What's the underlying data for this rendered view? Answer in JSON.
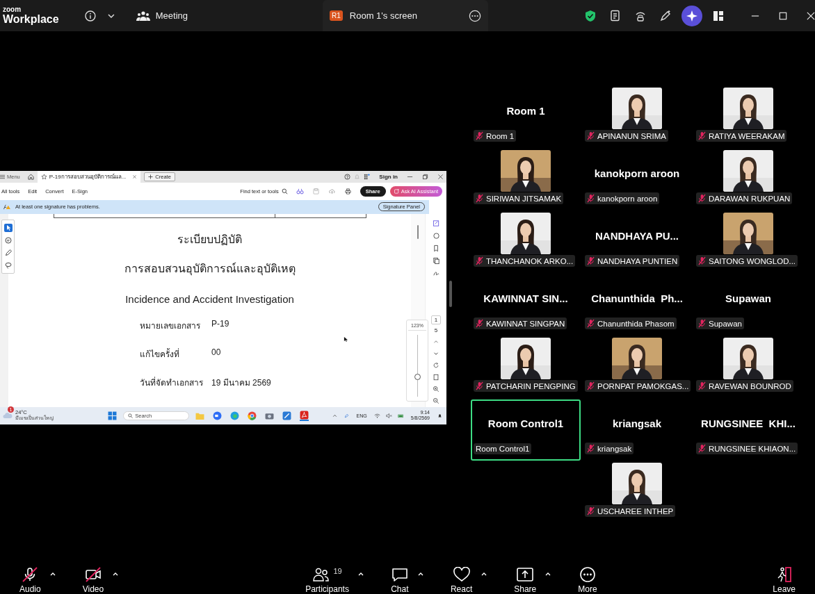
{
  "app": {
    "logo_small": "zoom",
    "logo_main": "Workplace"
  },
  "top_bar": {
    "meeting_label": "Meeting",
    "share_tab": {
      "badge": "R1",
      "title": "Room 1's screen"
    }
  },
  "shared_screen": {
    "acrobat": {
      "menu": "Menu",
      "tab_title": "P-19การสอบสวนอุบัติการณ์แล...",
      "create": "Create",
      "sign_in": "Sign in",
      "menus": [
        "All tools",
        "Edit",
        "Convert",
        "E-Sign"
      ],
      "find": "Find text or tools",
      "share": "Share",
      "ask_ai": "Ask AI Assistant",
      "banner": "At least one signature has problems.",
      "signature_panel": "Signature Panel"
    },
    "document": {
      "heading": "ระเบียบปฏิบัติ",
      "subheading": "การสอบสวนอุบัติการณ์และอุบัติเหตุ",
      "english_title": "Incidence and Accident Investigation",
      "fields": [
        {
          "label": "หมายเลขเอกสาร",
          "value": "P-19"
        },
        {
          "label": "แก้ไขครั้งที่",
          "value": "00"
        },
        {
          "label": "วันที่จัดทำเอกสาร",
          "value": "19 มีนาคม 2569"
        }
      ],
      "page_current": "1",
      "page_total": "5",
      "zoom": "123%"
    },
    "taskbar": {
      "weather_badge": "1",
      "temperature": "24°C",
      "weather": "มีเมฆเป็นส่วนใหญ่",
      "search": "Search",
      "language": "ENG",
      "time": "9:14",
      "date": "5/8/2569"
    }
  },
  "gallery": [
    {
      "kind": "name",
      "display": "Room 1",
      "label": "Room 1",
      "muted": true,
      "speaking": false
    },
    {
      "label": "APINANUN SRIMA",
      "muted": true,
      "speaking": false
    },
    {
      "label": "RATIYA WEERAKAM",
      "muted": true,
      "speaking": false
    },
    {
      "label": "SIRIWAN JITSAMAK",
      "muted": true,
      "speaking": false
    },
    {
      "kind": "name",
      "display": "kanokporn aroon",
      "label": "kanokporn aroon",
      "muted": true,
      "speaking": false
    },
    {
      "label": "DARAWAN RUKPUAN",
      "muted": true,
      "speaking": false
    },
    {
      "label": "THANCHANOK ARKO...",
      "muted": true,
      "speaking": false
    },
    {
      "kind": "name",
      "display": "NANDHAYA PU...",
      "label": "NANDHAYA PUNTIEN",
      "muted": true,
      "speaking": false
    },
    {
      "label": "SAITONG WONGLOD...",
      "muted": true,
      "speaking": false
    },
    {
      "kind": "name",
      "display": "KAWINNAT SIN...",
      "label": "KAWINNAT SINGPAN",
      "muted": true,
      "speaking": false
    },
    {
      "kind": "name",
      "display": "Chanunthida  Ph...",
      "label": "Chanunthida Phasom",
      "muted": true,
      "speaking": false
    },
    {
      "kind": "name",
      "display": "Supawan",
      "label": "Supawan",
      "muted": true,
      "speaking": false
    },
    {
      "label": "PATCHARIN PENGPING",
      "muted": true,
      "speaking": false
    },
    {
      "label": "PORNPAT PAMOKGAS...",
      "muted": true,
      "speaking": false
    },
    {
      "label": "RAVEWAN BOUNROD",
      "muted": true,
      "speaking": false
    },
    {
      "kind": "name",
      "display": "Room Control1",
      "label": "Room Control1",
      "muted": false,
      "speaking": true
    },
    {
      "kind": "name",
      "display": "kriangsak",
      "label": "kriangsak",
      "muted": true,
      "speaking": false
    },
    {
      "kind": "name",
      "display": "RUNGSINEE  KHI...",
      "label": "RUNGSINEE KHIAON...",
      "muted": true,
      "speaking": false
    },
    {
      "kind": "empty"
    },
    {
      "label": "USCHAREE INTHEP",
      "muted": true,
      "speaking": false
    }
  ],
  "toolbar": [
    {
      "kind": "audio",
      "label": "Audio",
      "muted": true,
      "has_menu": true
    },
    {
      "kind": "video",
      "label": "Video",
      "muted": true,
      "has_menu": true
    },
    {
      "kind": "participants",
      "label": "Participants",
      "count": "19",
      "has_menu": true
    },
    {
      "kind": "chat",
      "label": "Chat",
      "has_menu": true
    },
    {
      "kind": "react",
      "label": "React",
      "has_menu": true
    },
    {
      "kind": "share",
      "label": "Share",
      "has_menu": true
    },
    {
      "kind": "more",
      "label": "More",
      "has_menu": false
    },
    {
      "kind": "leave",
      "label": "Leave",
      "has_menu": false
    }
  ]
}
